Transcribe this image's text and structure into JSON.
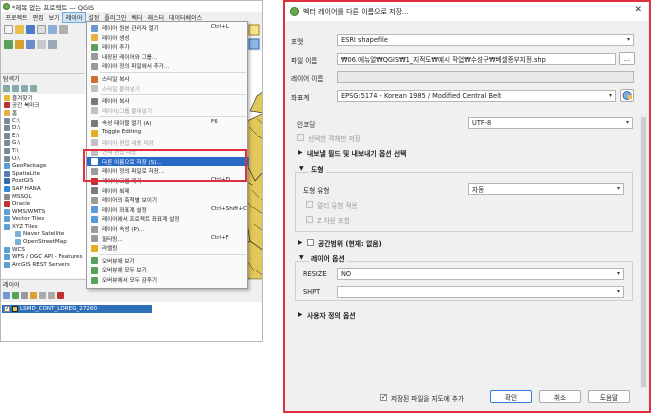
{
  "qgis": {
    "title": "*제목 없는 프로젝트 — QGIS",
    "menubar": [
      "프로젝트",
      "편집",
      "보기",
      "레이어",
      "설정",
      "플러그인",
      "벡터",
      "래스터",
      "데이터베이스"
    ],
    "active_menu_index": 3,
    "browser_title": "탐색기",
    "browser_items": [
      {
        "label": "즐겨찾기",
        "icon": "star-icon",
        "color": "#e8b830"
      },
      {
        "label": "공간 북마크",
        "icon": "bookmark-icon",
        "color": "#c03030"
      },
      {
        "label": "홈",
        "icon": "home-folder-icon",
        "color": "#e0b040"
      },
      {
        "label": "C:\\",
        "icon": "drive-icon",
        "color": "#7a8a9a"
      },
      {
        "label": "D:\\",
        "icon": "drive-icon",
        "color": "#7a8a9a"
      },
      {
        "label": "E:\\",
        "icon": "drive-icon",
        "color": "#7a8a9a"
      },
      {
        "label": "G:\\",
        "icon": "drive-icon",
        "color": "#7a8a9a"
      },
      {
        "label": "T:\\",
        "icon": "drive-icon",
        "color": "#7a8a9a"
      },
      {
        "label": "U:\\",
        "icon": "drive-icon",
        "color": "#7a8a9a"
      },
      {
        "label": "GeoPackage",
        "icon": "geopackage-icon",
        "color": "#5a9ad8"
      },
      {
        "label": "SpatiaLite",
        "icon": "spatialite-icon",
        "color": "#5a7ab8"
      },
      {
        "label": "PostGIS",
        "icon": "postgis-icon",
        "color": "#3a6aa8"
      },
      {
        "label": "SAP HANA",
        "icon": "sap-hana-icon",
        "color": "#2a8ad8"
      },
      {
        "label": "MSSQL",
        "icon": "mssql-icon",
        "color": "#8a8a8a"
      },
      {
        "label": "Oracle",
        "icon": "oracle-icon",
        "color": "#c83030"
      },
      {
        "label": "WMS/WMTS",
        "icon": "wms-icon",
        "color": "#5aa0d0"
      },
      {
        "label": "Vector Tiles",
        "icon": "vector-tiles-icon",
        "color": "#5aa0d0"
      },
      {
        "label": "XYZ Tiles",
        "icon": "xyz-tiles-icon",
        "color": "#5aa0d0"
      },
      {
        "label": "Naver Satellite",
        "icon": "tile-layer-icon",
        "color": "#7ab0d8",
        "indent": true
      },
      {
        "label": "OpenStreetMap",
        "icon": "tile-layer-icon",
        "color": "#7ab0d8",
        "indent": true
      },
      {
        "label": "WCS",
        "icon": "wcs-icon",
        "color": "#5aa0d0"
      },
      {
        "label": "WFS / OGC API - Features",
        "icon": "wfs-icon",
        "color": "#5aa0d0"
      },
      {
        "label": "ArcGIS REST Servers",
        "icon": "arcgis-icon",
        "color": "#5aa0d0"
      }
    ],
    "layers_title": "레이어",
    "layer_name": "LSMD_CONT_LDREG_27260",
    "layer_checked": "✓",
    "map_colors": {
      "fill": "#e2c85a",
      "stroke": "#222222"
    }
  },
  "context_menu": {
    "items": [
      {
        "label": "레이어 원본 관리자 열기",
        "shortcut": "Ctrl+L",
        "icon": "data-source-icon",
        "color": "#6a9ad0"
      },
      {
        "label": "레이어 생성",
        "shortcut": "",
        "icon": "new-layer-icon",
        "color": "#e8b040"
      },
      {
        "label": "레이어 추가",
        "shortcut": "",
        "icon": "add-layer-icon",
        "color": "#5aa05a"
      },
      {
        "label": "내장된 레이어와 그룹...",
        "shortcut": "",
        "icon": "embed-icon",
        "color": "#9a9a9a"
      },
      {
        "label": "레이어 정의 파일에서 추가...",
        "shortcut": "",
        "icon": "qlr-icon",
        "color": "#9a9a9a"
      },
      {
        "sep": true
      },
      {
        "label": "스타일 복사",
        "shortcut": "",
        "icon": "copy-style-icon",
        "color": "#d07030"
      },
      {
        "label": "스타일 붙여넣기",
        "shortcut": "",
        "icon": "paste-style-icon",
        "color": "#c0c0c0",
        "disabled": true
      },
      {
        "sep": true
      },
      {
        "label": "레이어 복사",
        "shortcut": "",
        "icon": "copy-layer-icon",
        "color": "#7a7a7a"
      },
      {
        "label": "레이어/그룹 붙여넣기",
        "shortcut": "",
        "icon": "paste-layer-icon",
        "color": "#c0c0c0",
        "disabled": true
      },
      {
        "sep": true
      },
      {
        "label": "속성 테이블 열기 (A)",
        "shortcut": "F6",
        "icon": "attribute-table-icon",
        "color": "#7a7a7a"
      },
      {
        "label": "Toggle Editing",
        "shortcut": "",
        "icon": "pencil-icon",
        "color": "#e0b020"
      },
      {
        "label": "레이어 편집 내용 저장",
        "shortcut": "",
        "icon": "save-edits-icon",
        "color": "#c0c0c0",
        "disabled": true
      },
      {
        "label": "현재 편집 내용",
        "shortcut": "",
        "icon": "current-edits-icon",
        "color": "#c0c0c0",
        "disabled": true
      },
      {
        "label": "다른 이름으로 저장 (S)...",
        "shortcut": "",
        "icon": "save-as-icon",
        "color": "#ffffff",
        "highlighted": true
      },
      {
        "label": "레이어 정의 파일로 저장...",
        "shortcut": "",
        "icon": "save-qlr-icon",
        "color": "#9a9a9a"
      },
      {
        "label": "레이어/그룹 제거",
        "shortcut": "Ctrl+D",
        "icon": "remove-layer-icon",
        "color": "#c03030"
      },
      {
        "label": "레이어 복제",
        "shortcut": "",
        "icon": "duplicate-icon",
        "color": "#7a7a7a"
      },
      {
        "label": "레이어의 축척별 보이기",
        "shortcut": "",
        "icon": "scale-visibility-icon",
        "color": "#9a9a9a"
      },
      {
        "label": "레이어 좌표계 설정",
        "shortcut": "Ctrl+Shift+C",
        "icon": "crs-icon",
        "color": "#5a9ad8"
      },
      {
        "label": "레이어에서 프로젝트 좌표계 설정",
        "shortcut": "",
        "icon": "project-crs-icon",
        "color": "#5a9ad8"
      },
      {
        "label": "레이어 속성 (P)...",
        "shortcut": "",
        "icon": "properties-icon",
        "color": "#9a9a9a"
      },
      {
        "label": "필터링...",
        "shortcut": "Ctrl+F",
        "icon": "filter-icon",
        "color": "#9a9a9a"
      },
      {
        "label": "라벨링",
        "shortcut": "",
        "icon": "labeling-icon",
        "color": "#e0b020"
      },
      {
        "sep": true
      },
      {
        "label": "오버뷰에 보기",
        "shortcut": "",
        "icon": "overview-icon",
        "color": "#5aa05a"
      },
      {
        "label": "오버뷰에 모두 보기",
        "shortcut": "",
        "icon": "overview-all-icon",
        "color": "#5aa05a"
      },
      {
        "label": "오버뷰에서 모두 감추기",
        "shortcut": "",
        "icon": "overview-hide-icon",
        "color": "#5aa05a"
      }
    ]
  },
  "dialog": {
    "title": "벡터 레이어를 다른 이름으로 저장...",
    "close_glyph": "✕",
    "format_label": "포맷",
    "format_value": "ESRI shapefile",
    "filename_label": "파일 이름",
    "filename_value": "₩06.에뉴얼₩QGIS₩1_지적도₩예시 작업₩수성구₩베셀중부지정.shp",
    "browse_label": "...",
    "layername_label": "레이어 이름",
    "layername_value": "",
    "crs_label": "좌표계",
    "crs_value": "EPSG:5174 - Korean 1985 / Modified Central Belt",
    "encoding_label": "인코딩",
    "encoding_value": "UTF-8",
    "save_selected_label": "선택한 객체만 저장",
    "export_fields_label": "내보낼 필드 및 내보내기 옵션 선택",
    "geometry_section_label": "도형",
    "geometry_type_label": "도형 유형",
    "geometry_type_value": "자동",
    "multi_type_label": "멀티 유형 적용",
    "z_dimension_label": "Z 차원 포함",
    "extent_label": "공간범위 (현재: 없음)",
    "layer_options_label": "레이어 옵션",
    "resize_label": "RESIZE",
    "resize_value": "NO",
    "shpt_label": "SHPT",
    "shpt_value": "",
    "custom_options_label": "사용자 정의 옵션",
    "add_to_map_label": "저장된 파일을 지도에 추가",
    "ok_label": "확인",
    "cancel_label": "취소",
    "help_label": "도움말",
    "expand_glyph": "▼",
    "collapse_glyph": "▶",
    "dropdown_glyph": "▾"
  },
  "colors": {
    "highlight_box": "#e03040",
    "selection": "#2a6ac7",
    "layer_selected": "#2d6fb8"
  }
}
